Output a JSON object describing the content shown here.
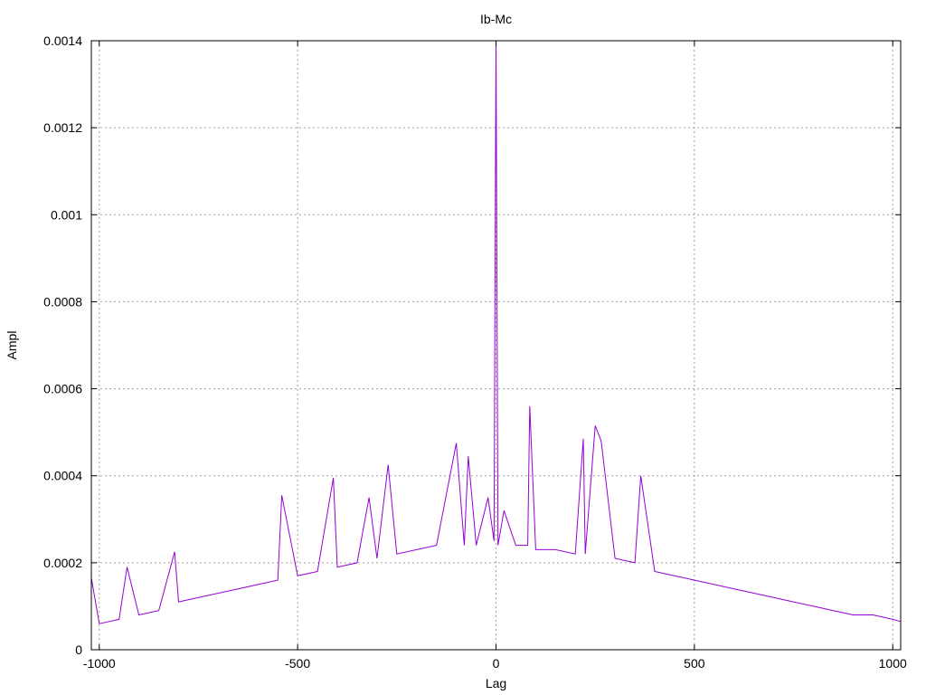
{
  "chart_data": {
    "type": "line",
    "title": "Ib-Mc",
    "xlabel": "Lag",
    "ylabel": "Ampl",
    "xlim": [
      -1020,
      1020
    ],
    "ylim": [
      0,
      0.0014
    ],
    "x_ticks": [
      -1000,
      -500,
      0,
      500,
      1000
    ],
    "y_ticks": [
      0,
      0.0002,
      0.0004,
      0.0006,
      0.0008,
      0.001,
      0.0012,
      0.0014
    ],
    "x_tick_labels": [
      "-1000",
      "-500",
      "0",
      "500",
      "1000"
    ],
    "y_tick_labels": [
      "0",
      "0.0002",
      "0.0004",
      "0.0006",
      "0.0008",
      "0.001",
      "0.0012",
      "0.0014"
    ],
    "grid": true,
    "series": [
      {
        "color": "#9400d3",
        "x": [
          -1020,
          -1000,
          -950,
          -930,
          -900,
          -850,
          -810,
          -800,
          -750,
          -700,
          -650,
          -600,
          -550,
          -540,
          -500,
          -450,
          -410,
          -400,
          -350,
          -320,
          -300,
          -272,
          -250,
          -200,
          -150,
          -100,
          -80,
          -70,
          -50,
          -20,
          -5,
          0,
          5,
          20,
          50,
          80,
          85,
          100,
          150,
          200,
          220,
          225,
          250,
          265,
          300,
          350,
          365,
          400,
          450,
          500,
          550,
          600,
          650,
          700,
          750,
          800,
          850,
          900,
          950,
          1000,
          1020
        ],
        "y": [
          0.000165,
          6e-05,
          7e-05,
          0.00019,
          8e-05,
          9e-05,
          0.000225,
          0.00011,
          0.00012,
          0.00013,
          0.00014,
          0.00015,
          0.00016,
          0.000355,
          0.00017,
          0.00018,
          0.000395,
          0.00019,
          0.0002,
          0.00035,
          0.00021,
          0.000425,
          0.00022,
          0.00023,
          0.00024,
          0.000475,
          0.00024,
          0.000445,
          0.00024,
          0.00035,
          0.00025,
          0.0014,
          0.00024,
          0.00032,
          0.00024,
          0.00024,
          0.00056,
          0.00023,
          0.00023,
          0.00022,
          0.000485,
          0.00022,
          0.000515,
          0.00048,
          0.00021,
          0.0002,
          0.0004,
          0.00018,
          0.00017,
          0.00016,
          0.00015,
          0.00014,
          0.00013,
          0.00012,
          0.00011,
          0.0001,
          9e-05,
          8e-05,
          8e-05,
          7e-05,
          6.5e-05
        ]
      }
    ]
  }
}
